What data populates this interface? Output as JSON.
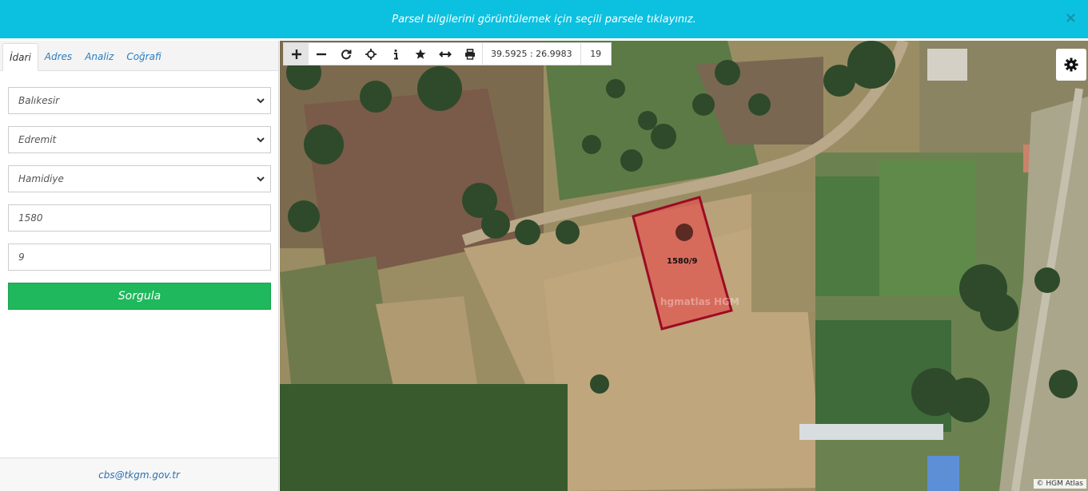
{
  "banner": {
    "message": "Parsel bilgilerini görüntülemek için seçili parsele tıklayınız.",
    "close_symbol": "×"
  },
  "tabs": [
    {
      "label": "İdari",
      "active": true
    },
    {
      "label": "Adres",
      "active": false
    },
    {
      "label": "Analiz",
      "active": false
    },
    {
      "label": "Coğrafi",
      "active": false
    }
  ],
  "form": {
    "province": "Balıkesir",
    "district": "Edremit",
    "neighborhood": "Hamidiye",
    "block": "1580",
    "parcel": "9",
    "query_label": "Sorgula"
  },
  "footer": {
    "email": "cbs@tkgm.gov.tr"
  },
  "toolbar": {
    "tools": [
      "plus-icon",
      "minus-icon",
      "refresh-icon",
      "locate-icon",
      "info-icon",
      "star-icon",
      "measure-icon",
      "print-icon"
    ],
    "coordinates": "39.5925 : 26.9983",
    "zoom_level": "19"
  },
  "map": {
    "parcel_label": "1580/9",
    "watermark": "hgmatlas HGM",
    "attribution": "© HGM Atlas",
    "parcel_fill": "#e0554f",
    "parcel_stroke": "#9b0b22"
  },
  "colors": {
    "banner": "#0bc1df",
    "query_button": "#1fb85c",
    "link": "#2a7bbf"
  }
}
